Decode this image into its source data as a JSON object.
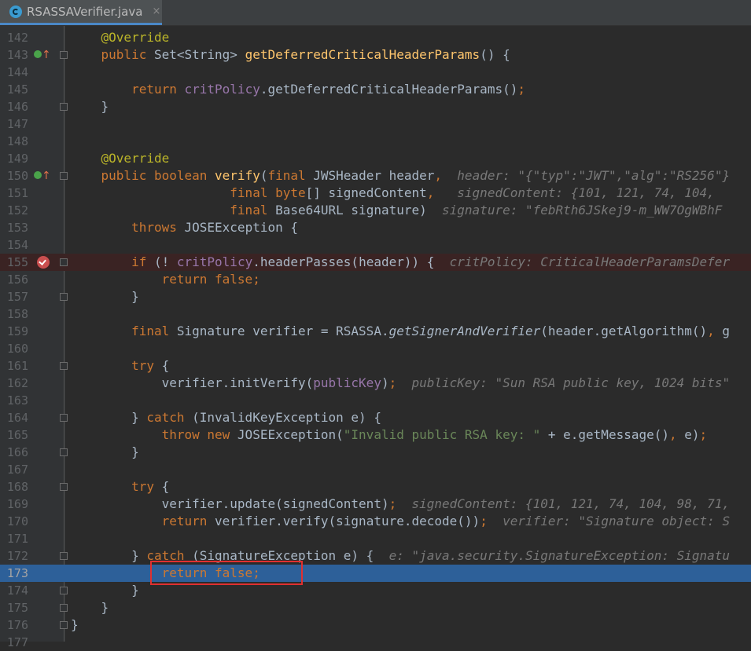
{
  "tab": {
    "title": "RSASSAVerifier.java",
    "close": "×"
  },
  "lines": [
    {
      "n": "142",
      "fold": false,
      "code": [
        [
          "ann",
          "    @Override"
        ]
      ]
    },
    {
      "n": "143",
      "impl": true,
      "fold": true,
      "code": [
        [
          "kw",
          "    public "
        ],
        [
          "",
          "Set<String> "
        ],
        [
          "fn",
          "getDeferredCriticalHeaderParams"
        ],
        [
          "",
          "() {"
        ]
      ]
    },
    {
      "n": "144",
      "code": []
    },
    {
      "n": "145",
      "code": [
        [
          "kw",
          "        return "
        ],
        [
          "fld",
          "critPolicy"
        ],
        [
          "",
          ".getDeferredCriticalHeaderParams()"
        ],
        [
          "kw",
          ";"
        ]
      ]
    },
    {
      "n": "146",
      "fold": true,
      "code": [
        [
          "",
          "    }"
        ]
      ]
    },
    {
      "n": "147",
      "code": []
    },
    {
      "n": "148",
      "code": []
    },
    {
      "n": "149",
      "code": [
        [
          "ann",
          "    @Override"
        ]
      ]
    },
    {
      "n": "150",
      "impl": true,
      "fold": true,
      "code": [
        [
          "kw",
          "    public boolean "
        ],
        [
          "fn",
          "verify"
        ],
        [
          "",
          "("
        ],
        [
          "kw",
          "final "
        ],
        [
          "",
          "JWSHeader header"
        ],
        [
          "kw",
          ",  "
        ],
        [
          "hint",
          "header: \"{\"typ\":\"JWT\",\"alg\":\"RS256\"}"
        ]
      ]
    },
    {
      "n": "151",
      "code": [
        [
          "kw",
          "                     final byte"
        ],
        [
          "",
          "[] signedContent"
        ],
        [
          "kw",
          ",   "
        ],
        [
          "hint",
          "signedContent: {101, 121, 74, 104,"
        ]
      ]
    },
    {
      "n": "152",
      "code": [
        [
          "kw",
          "                     final "
        ],
        [
          "",
          "Base64URL signature)  "
        ],
        [
          "hint",
          "signature: \"febRth6JSkej9-m_WW7OgWBhF"
        ]
      ]
    },
    {
      "n": "153",
      "code": [
        [
          "kw",
          "        throws "
        ],
        [
          "",
          "JOSEException {"
        ]
      ]
    },
    {
      "n": "154",
      "code": []
    },
    {
      "n": "155",
      "bp": true,
      "fold": true,
      "code": [
        [
          "kw",
          "        if "
        ],
        [
          "",
          "(! "
        ],
        [
          "fld",
          "critPolicy"
        ],
        [
          "",
          ".headerPasses(header)) {  "
        ],
        [
          "hint",
          "critPolicy: CriticalHeaderParamsDefer"
        ]
      ]
    },
    {
      "n": "156",
      "code": [
        [
          "kw",
          "            return false;"
        ]
      ]
    },
    {
      "n": "157",
      "fold": true,
      "code": [
        [
          "",
          "        }"
        ]
      ]
    },
    {
      "n": "158",
      "code": []
    },
    {
      "n": "159",
      "code": [
        [
          "kw",
          "        final "
        ],
        [
          "",
          "Signature verifier = RSASSA."
        ],
        [
          "st",
          "getSignerAndVerifier"
        ],
        [
          "",
          "(header.getAlgorithm()"
        ],
        [
          "kw",
          ", "
        ],
        [
          "",
          "g"
        ]
      ]
    },
    {
      "n": "160",
      "code": []
    },
    {
      "n": "161",
      "fold": true,
      "code": [
        [
          "kw",
          "        try "
        ],
        [
          "",
          "{"
        ]
      ]
    },
    {
      "n": "162",
      "code": [
        [
          "",
          "            verifier.initVerify("
        ],
        [
          "fld",
          "publicKey"
        ],
        [
          "",
          ")"
        ],
        [
          "kw",
          ";  "
        ],
        [
          "hint",
          "publicKey: \"Sun RSA public key, 1024 bits\""
        ]
      ]
    },
    {
      "n": "163",
      "code": []
    },
    {
      "n": "164",
      "fold": true,
      "code": [
        [
          "",
          "        } "
        ],
        [
          "kw",
          "catch "
        ],
        [
          "",
          "(InvalidKeyException e) {"
        ]
      ]
    },
    {
      "n": "165",
      "code": [
        [
          "kw",
          "            throw new "
        ],
        [
          "",
          "JOSEException("
        ],
        [
          "str",
          "\"Invalid public RSA key: \" "
        ],
        [
          "",
          "+ e.getMessage()"
        ],
        [
          "kw",
          ", "
        ],
        [
          "",
          "e)"
        ],
        [
          "kw",
          ";"
        ]
      ]
    },
    {
      "n": "166",
      "fold": true,
      "code": [
        [
          "",
          "        }"
        ]
      ]
    },
    {
      "n": "167",
      "code": []
    },
    {
      "n": "168",
      "fold": true,
      "code": [
        [
          "kw",
          "        try "
        ],
        [
          "",
          "{"
        ]
      ]
    },
    {
      "n": "169",
      "code": [
        [
          "",
          "            verifier.update(signedContent)"
        ],
        [
          "kw",
          ";  "
        ],
        [
          "hint",
          "signedContent: {101, 121, 74, 104, 98, 71,"
        ]
      ]
    },
    {
      "n": "170",
      "code": [
        [
          "kw",
          "            return "
        ],
        [
          "",
          "verifier.verify(signature.decode())"
        ],
        [
          "kw",
          ";  "
        ],
        [
          "hint",
          "verifier: \"Signature object: S"
        ]
      ]
    },
    {
      "n": "171",
      "code": []
    },
    {
      "n": "172",
      "fold": true,
      "code": [
        [
          "",
          "        } "
        ],
        [
          "kw",
          "catch "
        ],
        [
          "",
          "(SignatureException e) {  "
        ],
        [
          "hint",
          "e: \"java.security.SignatureException: Signatu"
        ]
      ]
    },
    {
      "n": "173",
      "current": true,
      "code": [
        [
          "kw",
          "            return false;"
        ]
      ]
    },
    {
      "n": "174",
      "fold": true,
      "code": [
        [
          "",
          "        }"
        ]
      ]
    },
    {
      "n": "175",
      "fold": true,
      "code": [
        [
          "",
          "    }"
        ]
      ]
    },
    {
      "n": "176",
      "fold": true,
      "code": [
        [
          "",
          "}"
        ]
      ]
    },
    {
      "n": "177",
      "code": []
    }
  ]
}
